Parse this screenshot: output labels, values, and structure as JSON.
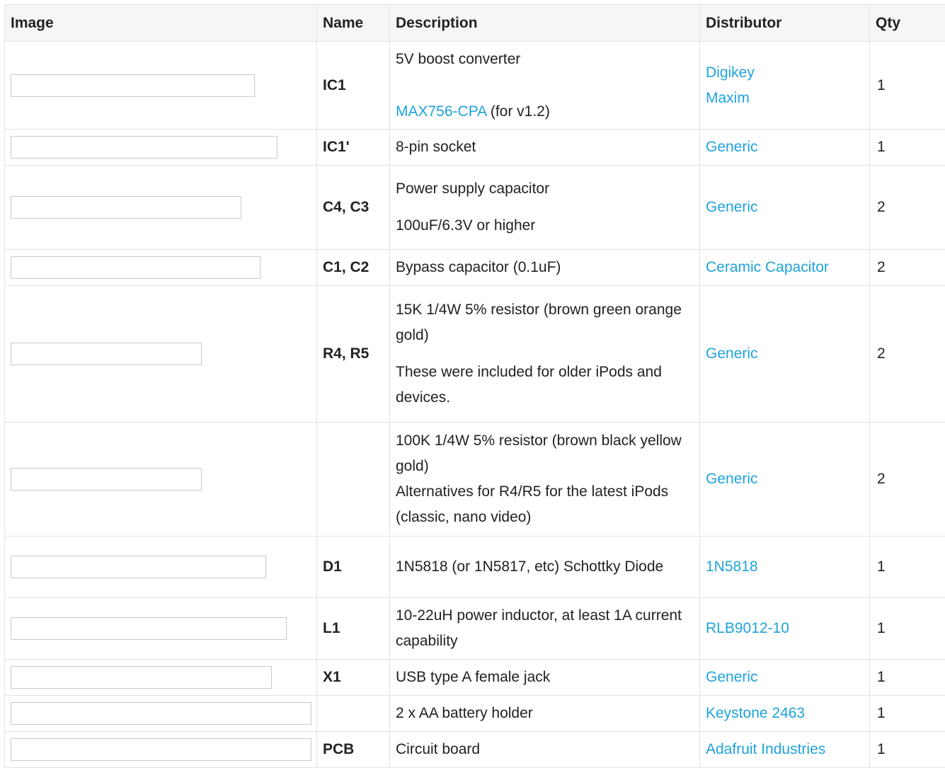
{
  "table": {
    "headers": {
      "image": "Image",
      "name": "Name",
      "description": "Description",
      "distributor": "Distributor",
      "qty": "Qty"
    },
    "rows": [
      {
        "name": "IC1",
        "description": {
          "line1": "5V boost converter",
          "link": "MAX756-CPA",
          "suffix": " (for v1.2)"
        },
        "distributors": [
          "Digikey",
          "Maxim"
        ],
        "qty": "1"
      },
      {
        "name": "IC1'",
        "description": "8-pin socket",
        "distributors": [
          "Generic"
        ],
        "qty": "1"
      },
      {
        "name": "C4, C3",
        "description": {
          "line1": "Power supply capacitor",
          "line2": "100uF/6.3V or higher"
        },
        "distributors": [
          "Generic"
        ],
        "qty": "2"
      },
      {
        "name": "C1, C2",
        "description": "Bypass capacitor (0.1uF)",
        "distributors": [
          "Ceramic Capacitor"
        ],
        "qty": "2"
      },
      {
        "name": "R4, R5",
        "description": {
          "line1": "15K 1/4W 5% resistor (brown green orange gold)",
          "line2": "These were included for older iPods and devices."
        },
        "distributors": [
          "Generic"
        ],
        "qty": "2"
      },
      {
        "name": "",
        "description": {
          "line1": "100K 1/4W 5% resistor (brown black yellow gold)",
          "line2": "Alternatives for R4/R5 for the latest iPods (classic, nano video)"
        },
        "distributors": [
          "Generic"
        ],
        "qty": "2"
      },
      {
        "name": "D1",
        "description": "1N5818 (or 1N5817, etc) Schottky Diode",
        "distributors": [
          "1N5818"
        ],
        "qty": "1"
      },
      {
        "name": "L1",
        "description": "10-22uH power inductor, at least 1A current capability",
        "distributors": [
          "RLB9012-10"
        ],
        "qty": "1"
      },
      {
        "name": "X1",
        "description": "USB type A female jack",
        "distributors": [
          "Generic"
        ],
        "qty": "1"
      },
      {
        "name": "",
        "description": "2 x AA battery holder",
        "distributors": [
          "Keystone 2463"
        ],
        "qty": "1"
      },
      {
        "name": "PCB",
        "description": "Circuit board",
        "distributors": [
          "Adafruit Industries"
        ],
        "qty": "1"
      }
    ]
  },
  "colors": {
    "link": "#1fa3dc",
    "header_bg": "#f6f6f6",
    "border": "#e3e3e3",
    "text": "#222222"
  }
}
